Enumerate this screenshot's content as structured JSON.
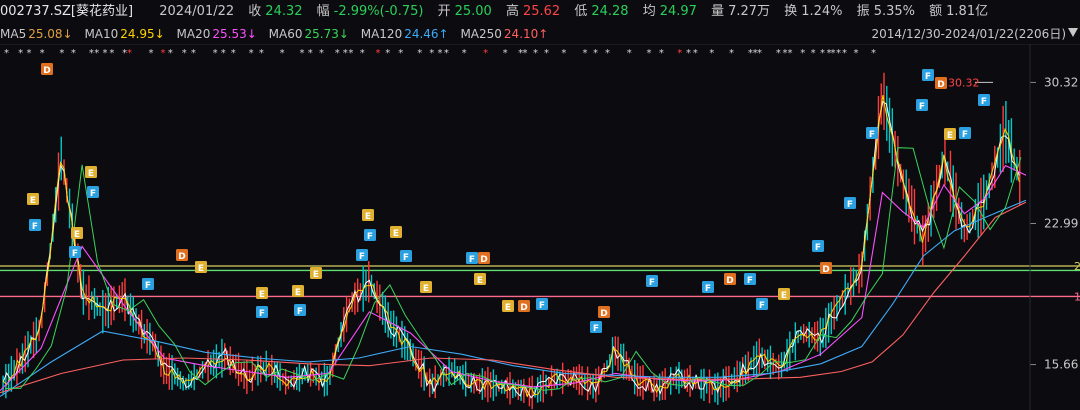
{
  "header": {
    "code": "002737.SZ[葵花药业]",
    "date": "2024/01/22",
    "close_label": "收",
    "close": "24.32",
    "change_label": "幅",
    "change": "-2.99%(-0.75)",
    "open_label": "开",
    "open": "25.00",
    "high_label": "高",
    "high": "25.62",
    "low_label": "低",
    "low": "24.28",
    "avg_label": "均",
    "avg": "24.97",
    "vol_label": "量",
    "vol": "7.27万",
    "turn_label": "换",
    "turn": "1.24%",
    "amp_label": "振",
    "amp": "5.35%",
    "amt_label": "额",
    "amt": "1.81亿"
  },
  "ma": {
    "ma5_label": "MA5",
    "ma5": "25.08↓",
    "ma10_label": "MA10",
    "ma10": "24.95↓",
    "ma20_label": "MA20",
    "ma20": "25.53↓",
    "ma60_label": "MA60",
    "ma60": "25.73↓",
    "ma120_label": "MA120",
    "ma120": "24.46↑",
    "ma250_label": "MA250",
    "ma250": "24.10↑",
    "range": "2014/12/30-2024/01/22(2206日)"
  },
  "colors": {
    "up": "#ff3b3b",
    "down": "#00c9c9",
    "ma5": "#ffffff",
    "ma10": "#ffd200",
    "ma20": "#ff4fff",
    "ma60": "#3cd45a",
    "ma120": "#3fa9f5",
    "ma250": "#ff6060"
  },
  "chart_data": {
    "type": "line",
    "y_ticks": [
      "30.32",
      "22.99",
      "15.66"
    ],
    "ylim": [
      13.3,
      31.9
    ],
    "max_label": "30.32",
    "hlines": [
      {
        "value": 20.78,
        "color": "#d8d060",
        "label": "2"
      },
      {
        "value": 20.55,
        "color": "#5fe070",
        "label": ""
      },
      {
        "value": 19.2,
        "color": "#ff6b8b",
        "label": "1"
      }
    ],
    "series": [
      {
        "key": "price",
        "x": [
          0,
          2,
          4,
          6,
          8,
          10,
          12,
          14,
          15,
          16,
          17,
          18,
          20,
          22,
          24,
          26,
          28,
          30,
          32,
          34,
          36,
          38,
          40,
          42,
          44,
          46,
          48,
          50,
          52,
          54,
          56,
          58,
          60,
          62,
          64,
          66,
          68,
          70,
          72,
          74,
          76,
          78,
          80,
          82,
          84,
          86,
          88,
          90,
          92,
          94,
          96,
          98,
          100
        ],
        "values": [
          14.4,
          15.8,
          17.6,
          26.5,
          19.5,
          18.4,
          19.2,
          17.3,
          16.8,
          15.4,
          15.2,
          14.6,
          15.5,
          16.1,
          15.0,
          15.6,
          14.7,
          15.2,
          14.8,
          18.7,
          20.0,
          17.8,
          16.4,
          14.6,
          15.4,
          14.7,
          14.6,
          14.4,
          14.2,
          14.9,
          15.0,
          14.5,
          16.4,
          14.9,
          14.4,
          15.0,
          14.7,
          14.4,
          15.1,
          16.1,
          15.5,
          17.3,
          17.1,
          19.0,
          20.6,
          29.7,
          25.1,
          22.0,
          26.4,
          22.6,
          24.2,
          27.8,
          24.3
        ]
      },
      {
        "key": "ma20",
        "x": [
          0,
          4,
          8,
          12,
          16,
          20,
          24,
          28,
          32,
          36,
          40,
          44,
          48,
          52,
          56,
          60,
          64,
          68,
          72,
          76,
          80,
          84,
          86,
          88,
          90,
          92,
          94,
          96,
          98,
          100
        ],
        "values": [
          14.3,
          16.5,
          21.8,
          18.8,
          16.0,
          15.6,
          15.3,
          15.0,
          15.2,
          18.4,
          17.3,
          15.3,
          14.8,
          14.5,
          14.7,
          15.2,
          14.9,
          14.8,
          14.9,
          15.3,
          16.2,
          18.1,
          24.6,
          23.6,
          22.8,
          25.0,
          23.5,
          24.3,
          26.0,
          25.5
        ]
      },
      {
        "key": "ma120",
        "x": [
          0,
          5,
          10,
          15,
          20,
          25,
          30,
          35,
          40,
          45,
          50,
          55,
          60,
          65,
          70,
          75,
          80,
          84,
          87,
          90,
          93,
          96,
          100
        ],
        "values": [
          14.0,
          15.8,
          17.4,
          16.9,
          16.3,
          16.0,
          15.8,
          16.0,
          16.6,
          16.2,
          15.6,
          15.2,
          15.1,
          15.0,
          15.0,
          15.2,
          15.7,
          16.6,
          18.8,
          21.3,
          22.6,
          23.3,
          24.2
        ]
      },
      {
        "key": "ma250",
        "x": [
          0,
          6,
          12,
          18,
          24,
          30,
          36,
          42,
          48,
          54,
          60,
          66,
          72,
          78,
          82,
          85,
          88,
          91,
          94,
          97,
          100
        ],
        "values": [
          14.2,
          15.2,
          15.9,
          16.0,
          15.9,
          15.7,
          15.6,
          16.0,
          15.9,
          15.4,
          15.0,
          14.9,
          14.9,
          15.0,
          15.3,
          15.8,
          17.2,
          19.4,
          21.3,
          23.3,
          24.1
        ]
      }
    ]
  }
}
